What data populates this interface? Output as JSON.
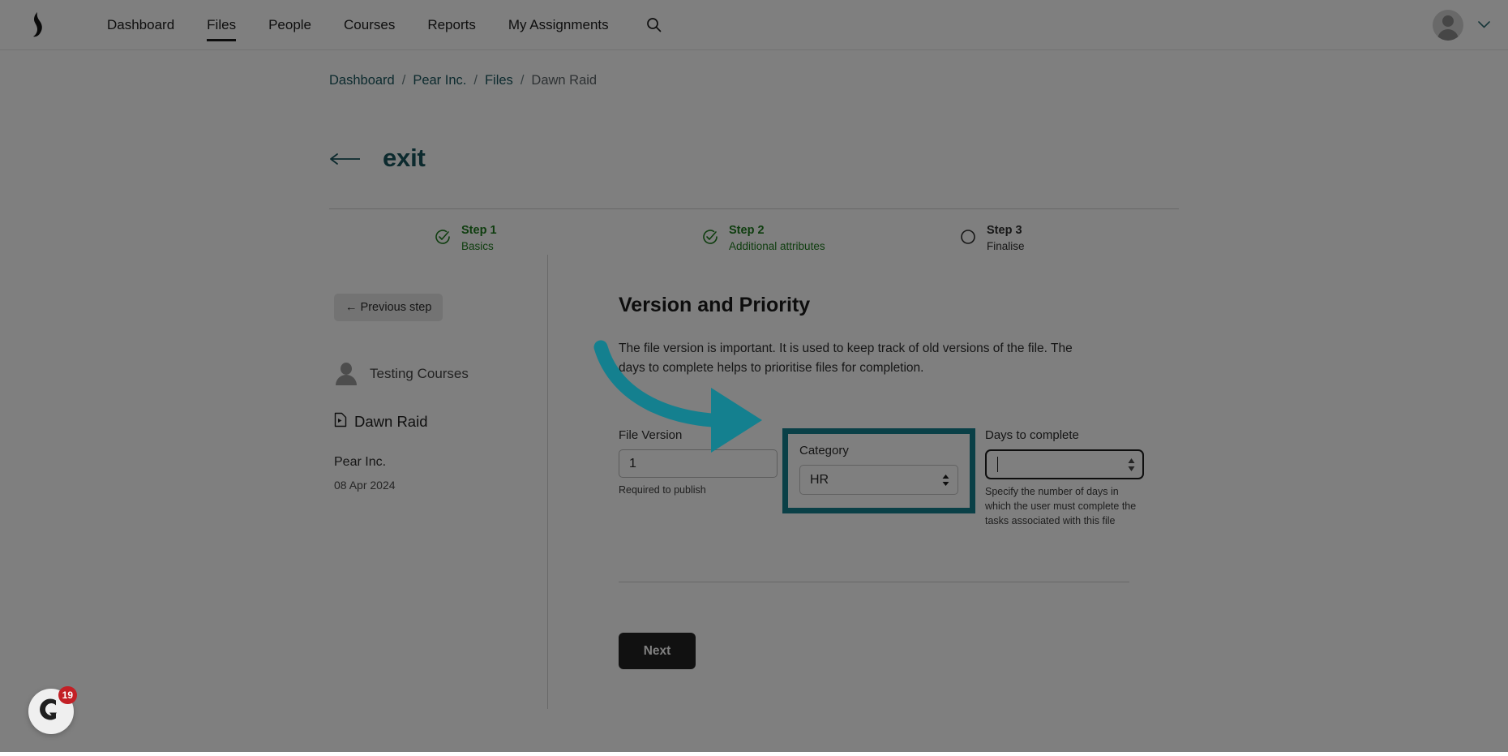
{
  "topnav": {
    "logo_icon": "brand-logo-icon",
    "items": [
      {
        "label": "Dashboard",
        "active": false
      },
      {
        "label": "Files",
        "active": true
      },
      {
        "label": "People",
        "active": false
      },
      {
        "label": "Courses",
        "active": false
      },
      {
        "label": "Reports",
        "active": false
      },
      {
        "label": "My Assignments",
        "active": false
      }
    ],
    "search_icon": "search-icon",
    "avatar_icon": "user-avatar-icon",
    "chevron_icon": "chevron-down-icon"
  },
  "breadcrumb": {
    "items": [
      "Dashboard",
      "Pear Inc.",
      "Files",
      "Dawn Raid"
    ],
    "separator": "/"
  },
  "exit": {
    "arrow": "←",
    "label": "exit"
  },
  "stepper": {
    "steps": [
      {
        "title": "Step 1",
        "sub": "Basics",
        "state": "done"
      },
      {
        "title": "Step 2",
        "sub": "Additional attributes",
        "state": "done"
      },
      {
        "title": "Step 3",
        "sub": "Finalise",
        "state": "todo"
      }
    ]
  },
  "sidebar": {
    "previous_step_label": "← Previous step",
    "owner": "Testing Courses",
    "file_name": "Dawn Raid",
    "org_name": "Pear Inc.",
    "org_date": "08 Apr 2024"
  },
  "form": {
    "title": "Version and Priority",
    "description": "The file version is important. It is used to keep track of old versions of the file. The days to complete helps to prioritise files for completion.",
    "version": {
      "label": "File Version",
      "value": "1",
      "help": "Required to publish"
    },
    "category": {
      "label": "Category",
      "value": "HR",
      "highlighted": true
    },
    "days": {
      "label": "Days to complete",
      "value": "",
      "help": "Specify the number of days in which the user must complete the tasks associated with this file",
      "focused": true
    },
    "next_label": "Next"
  },
  "help_widget": {
    "badge_count": "19",
    "icon": "chat-help-icon"
  },
  "colors": {
    "accent_teal": "#14808f",
    "link_teal": "#18555c",
    "step_done_green": "#1d7a1d",
    "badge_red": "#c32026",
    "button_dark": "#232323"
  }
}
